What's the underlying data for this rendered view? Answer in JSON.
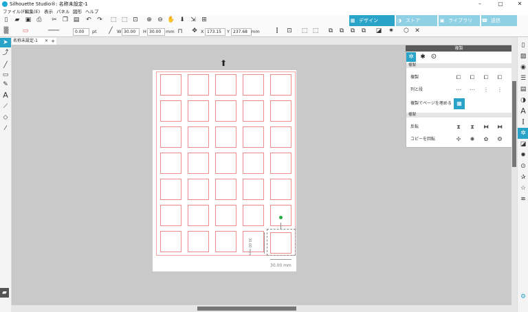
{
  "window": {
    "title": "Silhouette Studio®: 名称未設定-1",
    "minimize": "–",
    "maximize": "▢",
    "close": "✕"
  },
  "menu": [
    "ファイル(F)",
    "編集(E)",
    "表示",
    "パネル",
    "図形",
    "ヘルプ"
  ],
  "nav_tabs": [
    {
      "label": "デザイン",
      "icon": "grid-icon",
      "glyph": "▦"
    },
    {
      "label": "ストア",
      "icon": "store-icon",
      "glyph": "◑"
    },
    {
      "label": "ライブラリ",
      "icon": "library-icon",
      "glyph": "▣"
    },
    {
      "label": "送信",
      "icon": "send-icon",
      "glyph": "☎"
    }
  ],
  "toolbar2": {
    "line_width": "0.00",
    "line_unit": "pt",
    "w_label": "W",
    "w_value": "30.00",
    "h_label": "H",
    "h_value": "30.00",
    "wh_unit": "mm",
    "x_label": "X",
    "x_value": "173.15",
    "y_label": "Y",
    "y_value": "237.68",
    "xy_unit": "mm"
  },
  "document_tab": {
    "name": "名称未設定-1",
    "close": "×",
    "add": "+"
  },
  "canvas": {
    "rows": 7,
    "cols": 5,
    "dimension_width": "30.00 mm",
    "dimension_height": "30.00 mm"
  },
  "panel": {
    "title": "複製",
    "sections": [
      {
        "header": "複製",
        "rows": [
          "複製",
          "列と段",
          "複製でページを埋める"
        ]
      },
      {
        "header": "複製",
        "rows": [
          "反転",
          "コピーを回転"
        ]
      }
    ]
  },
  "colors": {
    "accent": "#2aa3c8",
    "cut_line": "#e88c8c",
    "select_handle": "#22aa44"
  }
}
